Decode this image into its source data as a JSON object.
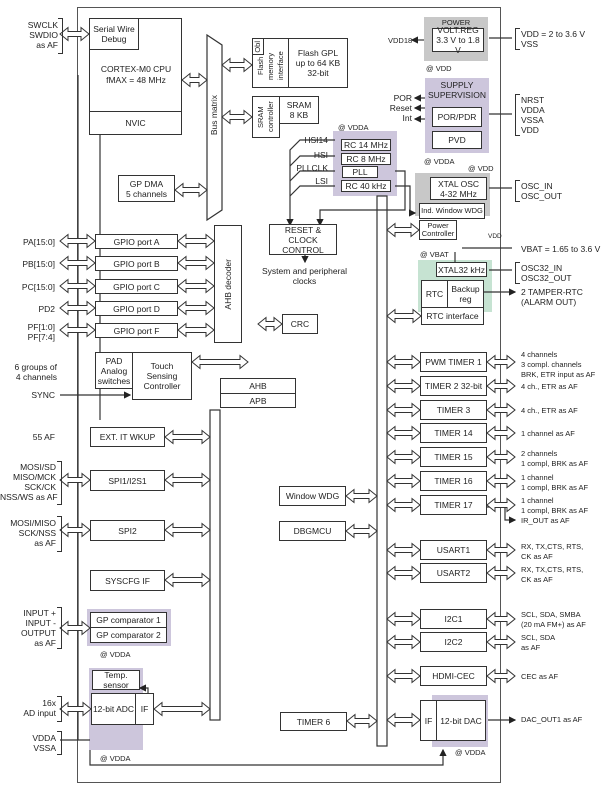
{
  "left_pins": {
    "swd": [
      "SWCLK",
      "SWDIO",
      "as AF"
    ],
    "gpio": [
      "PA[15:0]",
      "PB[15:0]",
      "PC[15:0]",
      "PD2",
      "PF[1:0]",
      "PF[7:4]"
    ],
    "touch": [
      "6 groups of",
      "4 channels"
    ],
    "sync": "SYNC",
    "exti": "55 AF",
    "spi1": [
      "MOSI/SD",
      "MISO/MCK",
      "SCK/CK",
      "NSS/WS as AF"
    ],
    "spi2": [
      "MOSI/MISO",
      "SCK/NSS",
      "as AF"
    ],
    "comp": [
      "INPUT +",
      "INPUT -",
      "OUTPUT",
      "as AF"
    ],
    "adc": [
      "16x",
      "AD input"
    ],
    "vdda_pins": [
      "VDDA",
      "VSSA"
    ]
  },
  "blocks": {
    "swd": "Serial Wire Debug",
    "cpu": "CORTEX-M0 CPU",
    "cpu_freq": "fMAX = 48 MHz",
    "nvic": "NVIC",
    "bus_matrix": "Bus matrix",
    "flash_obl": "Obl",
    "flash_if": "Flash memory interface",
    "flash": [
      "Flash GPL",
      "up to 64 KB",
      "32-bit"
    ],
    "sram_ctrl": "SRAM controller",
    "sram": [
      "SRAM",
      "8 KB"
    ],
    "dma": [
      "GP DMA",
      "5 channels"
    ],
    "gpio": [
      "GPIO port A",
      "GPIO port B",
      "GPIO port C",
      "GPIO port D",
      "GPIO port F"
    ],
    "ahb_decoder": "AHB decoder",
    "reset_clock": [
      "RESET & CLOCK",
      "CONTROL"
    ],
    "sys_clocks": [
      "System and peripheral",
      "clocks"
    ],
    "crc": "CRC",
    "pad": [
      "PAD",
      "Analog",
      "switches"
    ],
    "tsc": [
      "Touch",
      "Sensing",
      "Controller"
    ],
    "ahb": "AHB",
    "apb": "APB",
    "exti": "EXT. IT  WKUP",
    "spi1": "SPI1/I2S1",
    "spi2": "SPI2",
    "syscfg": "SYSCFG IF",
    "comp1": "GP comparator 1",
    "comp2": "GP comparator 2",
    "temp": [
      "Temp.",
      "sensor"
    ],
    "adc": "12-bit ADC",
    "adc_if": "IF",
    "wwdg": "Window WDG",
    "dbgmcu": "DBGMCU",
    "timer6": "TIMER 6",
    "power_title": "POWER",
    "voltreg": [
      "VOLT.REG",
      "3.3 V to 1.8 V"
    ],
    "supply_title": [
      "SUPPLY",
      "SUPERVISION"
    ],
    "por": "POR/PDR",
    "pvd": "PVD",
    "rc14": "RC 14 MHz",
    "rc8": "RC 8 MHz",
    "pll": "PLL",
    "rc40": "RC 40 kHz",
    "xtal": [
      "XTAL OSC",
      "4-32 MHz"
    ],
    "iwdg": "Ind. Window WDG",
    "pwrctrl": [
      "Power",
      "Controller"
    ],
    "xtal32": "XTAL32 kHz",
    "rtc": "RTC",
    "backup": [
      "Backup",
      "reg"
    ],
    "rtc_if": "RTC interface",
    "timers": [
      "PWM TIMER 1",
      "TIMER 2 32-bit",
      "TIMER 3",
      "TIMER 14",
      "TIMER 15",
      "TIMER 16",
      "TIMER 17"
    ],
    "usart": [
      "USART1",
      "USART2"
    ],
    "i2c": [
      "I2C1",
      "I2C2"
    ],
    "cec": "HDMI-CEC",
    "dac_if": "IF",
    "dac": "12-bit  DAC"
  },
  "clock_labels": [
    "HSI14",
    "HSI",
    "PLLCLK",
    "LSI"
  ],
  "domain_labels": {
    "vdd": "@ VDD",
    "vdda": "@ VDDA",
    "vbat": "@ VBAT",
    "vdd18": "VDD18",
    "vdd_small": "VDD"
  },
  "supervision_outputs": [
    "POR",
    "Reset",
    "Int"
  ],
  "right_pins": {
    "power": [
      "VDD = 2 to 3.6 V",
      "VSS"
    ],
    "supply": [
      "NRST",
      "VDDA",
      "VSSA",
      "VDD"
    ],
    "osc": [
      "OSC_IN",
      "OSC_OUT"
    ],
    "vbat": "VBAT = 1.65 to 3.6 V",
    "osc32": [
      "OSC32_IN",
      "OSC32_OUT"
    ],
    "tamper": [
      "2 TAMPER-RTC",
      "(ALARM OUT)"
    ],
    "timers": [
      [
        "4 channels",
        "3 compl. channels",
        "BRK, ETR input as AF"
      ],
      [
        "4 ch., ETR as AF"
      ],
      [
        "4 ch., ETR as AF"
      ],
      [
        "1 channel as AF"
      ],
      [
        "2 channels",
        "1 compl, BRK as AF"
      ],
      [
        "1 channel",
        "1 compl, BRK as AF"
      ],
      [
        "1 channel",
        "1 compl, BRK as AF"
      ]
    ],
    "ir_out": "IR_OUT as AF",
    "usart": [
      [
        "RX, TX,CTS, RTS,",
        "CK as AF"
      ],
      [
        "RX, TX,CTS, RTS,",
        "CK as AF"
      ]
    ],
    "i2c": [
      [
        "SCL, SDA, SMBA",
        "(20 mA FM+) as AF"
      ],
      [
        "SCL, SDA",
        "as AF"
      ]
    ],
    "cec": "CEC as AF",
    "dac": "DAC_OUT1 as AF"
  },
  "colors": {
    "gray_domain": "#c8c8c8",
    "purple_domain": "#cdc6dc",
    "green_domain": "#c6e3d2",
    "line": "#333333"
  }
}
